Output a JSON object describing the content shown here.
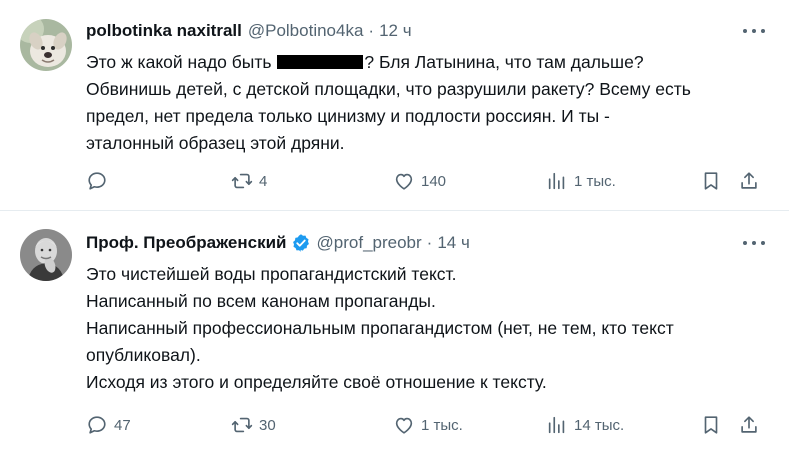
{
  "tweets": [
    {
      "name": "polbotinka naxitrall",
      "handle": "@Polbotino4ka",
      "sep": "·",
      "time": "12 ч",
      "lines": {
        "l1_pre": "Это ж какой надо быть",
        "l1_post": "? Бля Латынина, что там дальше?",
        "l2": "Обвинишь детей, с детской площадки, что разрушили ракету? Всему есть",
        "l3": "предел, нет предела только цинизму и подлости россиян. И ты -",
        "l4": "эталонный образец этой дряни."
      },
      "stats": {
        "replies": "",
        "reposts": "4",
        "likes": "140",
        "views": "1 тыс."
      }
    },
    {
      "name": "Проф. Преображенский",
      "handle": "@prof_preobr",
      "sep": "·",
      "time": "14 ч",
      "lines": {
        "l1": "Это чистейшей воды пропагандистский текст.",
        "l2": "Написанный по всем канонам пропаганды.",
        "l3": "Написанный профессиональным пропагандистом (нет, не тем, кто текст",
        "l4": "опубликовал).",
        "l5": "Исходя из этого и определяйте своё отношение к тексту."
      },
      "stats": {
        "replies": "47",
        "reposts": "30",
        "likes": "1 тыс.",
        "views": "14 тыс."
      }
    }
  ],
  "colors": {
    "text": "#0f1419",
    "muted": "#536471",
    "verified": "#1d9bf0",
    "divider": "#e6ecf0"
  },
  "icons": [
    "reply-icon",
    "repost-icon",
    "like-icon",
    "views-icon",
    "bookmark-icon",
    "share-icon",
    "more-icon",
    "verified-icon"
  ]
}
